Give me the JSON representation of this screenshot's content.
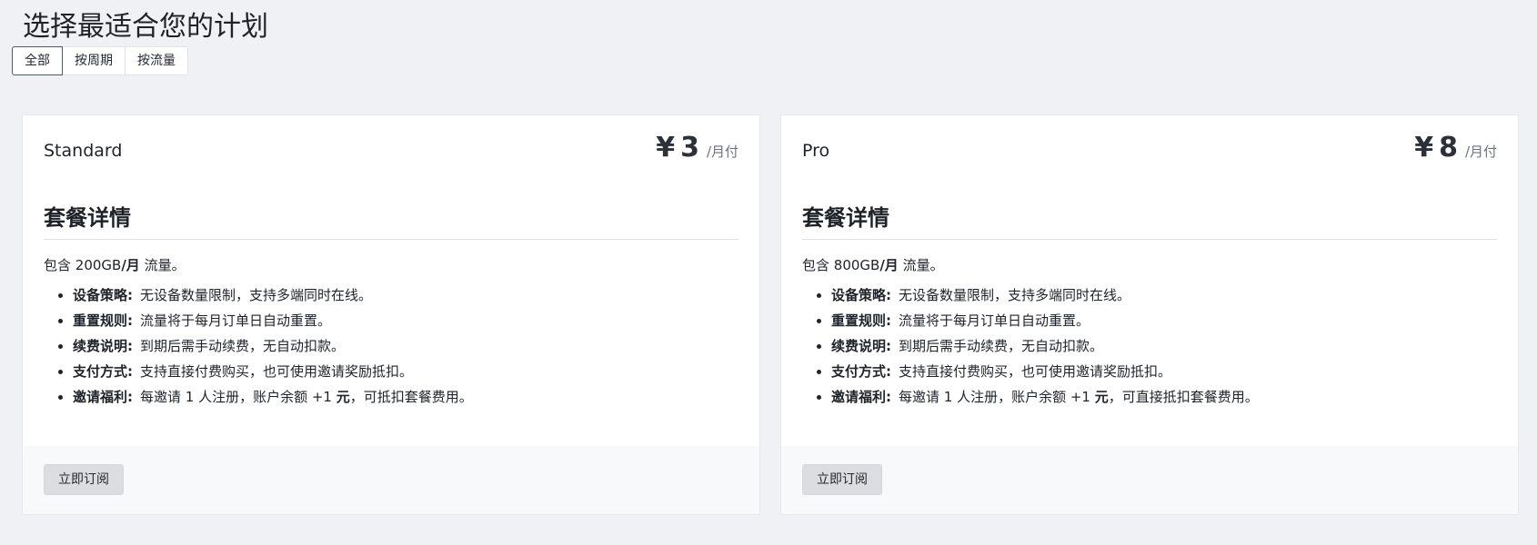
{
  "page": {
    "title": "选择最适合您的计划"
  },
  "tabs": [
    {
      "label": "全部",
      "active": true
    },
    {
      "label": "按周期",
      "active": false
    },
    {
      "label": "按流量",
      "active": false
    }
  ],
  "plans": [
    {
      "name": "Standard",
      "currency": "¥",
      "amount": "3",
      "period": "/月付",
      "section_title": "套餐详情",
      "traffic_prefix": "包含 ",
      "traffic_amount": "200GB",
      "traffic_unit": "/月",
      "traffic_suffix": " 流量。",
      "features": [
        {
          "label": "设备策略:",
          "text": "无设备数量限制，支持多端同时在线。"
        },
        {
          "label": "重置规则:",
          "text": "流量将于每月订单日自动重置。"
        },
        {
          "label": "续费说明:",
          "text": "到期后需手动续费，无自动扣款。"
        },
        {
          "label": "支付方式:",
          "text": "支持直接付费购买，也可使用邀请奖励抵扣。"
        },
        {
          "label": "邀请福利:",
          "text": "每邀请 1 人注册，账户余额 +1 ",
          "bold": "元",
          "text_end": "，可抵扣套餐费用。"
        }
      ],
      "button_label": "立即订阅"
    },
    {
      "name": "Pro",
      "currency": "¥",
      "amount": "8",
      "period": "/月付",
      "section_title": "套餐详情",
      "traffic_prefix": "包含 ",
      "traffic_amount": "800GB",
      "traffic_unit": "/月",
      "traffic_suffix": " 流量。",
      "features": [
        {
          "label": "设备策略:",
          "text": "无设备数量限制，支持多端同时在线。"
        },
        {
          "label": "重置规则:",
          "text": "流量将于每月订单日自动重置。"
        },
        {
          "label": "续费说明:",
          "text": "到期后需手动续费，无自动扣款。"
        },
        {
          "label": "支付方式:",
          "text": "支持直接付费购买，也可使用邀请奖励抵扣。"
        },
        {
          "label": "邀请福利:",
          "text": "每邀请 1 人注册，账户余额 +1 ",
          "bold": "元",
          "text_end": "，可直接抵扣套餐费用。"
        }
      ],
      "button_label": "立即订阅"
    }
  ],
  "colors": {
    "page_background": "#f0f1f4",
    "card_background": "#ffffff",
    "footer_background": "#f8f9fb",
    "button_background": "#dcdde0",
    "active_tab_border": "#525a63"
  }
}
